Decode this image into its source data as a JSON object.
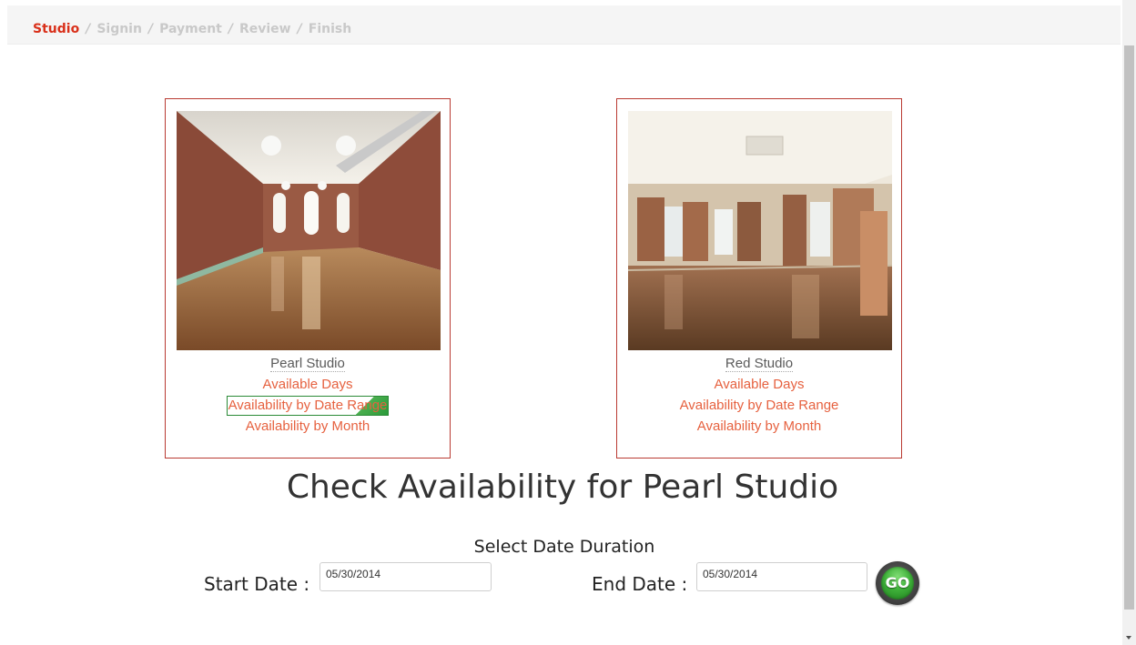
{
  "breadcrumb": {
    "items": [
      "Studio",
      "Signin",
      "Payment",
      "Review",
      "Finish"
    ],
    "separator": "/",
    "active_color": "#d9301a",
    "inactive_color": "#c9c9c9"
  },
  "studios": [
    {
      "name": "Pearl Studio",
      "photo_icon": "pearl-studio-photo",
      "links": [
        "Available Days",
        "Availability by Date Range",
        "Availability by Month"
      ],
      "selected_link_index": 1
    },
    {
      "name": "Red Studio",
      "photo_icon": "red-studio-photo",
      "links": [
        "Available Days",
        "Availability by Date Range",
        "Availability by Month"
      ]
    }
  ],
  "availability": {
    "heading": "Check Availability for Pearl Studio",
    "subheading": "Select Date Duration",
    "start_label": "Start Date :",
    "start_value": "05/30/2014",
    "end_label": "End Date :",
    "end_value": "05/30/2014",
    "go_label": "GO"
  },
  "colors": {
    "card_border": "#b93a32",
    "link": "#e6613f",
    "go_green": "#3fb23a"
  }
}
